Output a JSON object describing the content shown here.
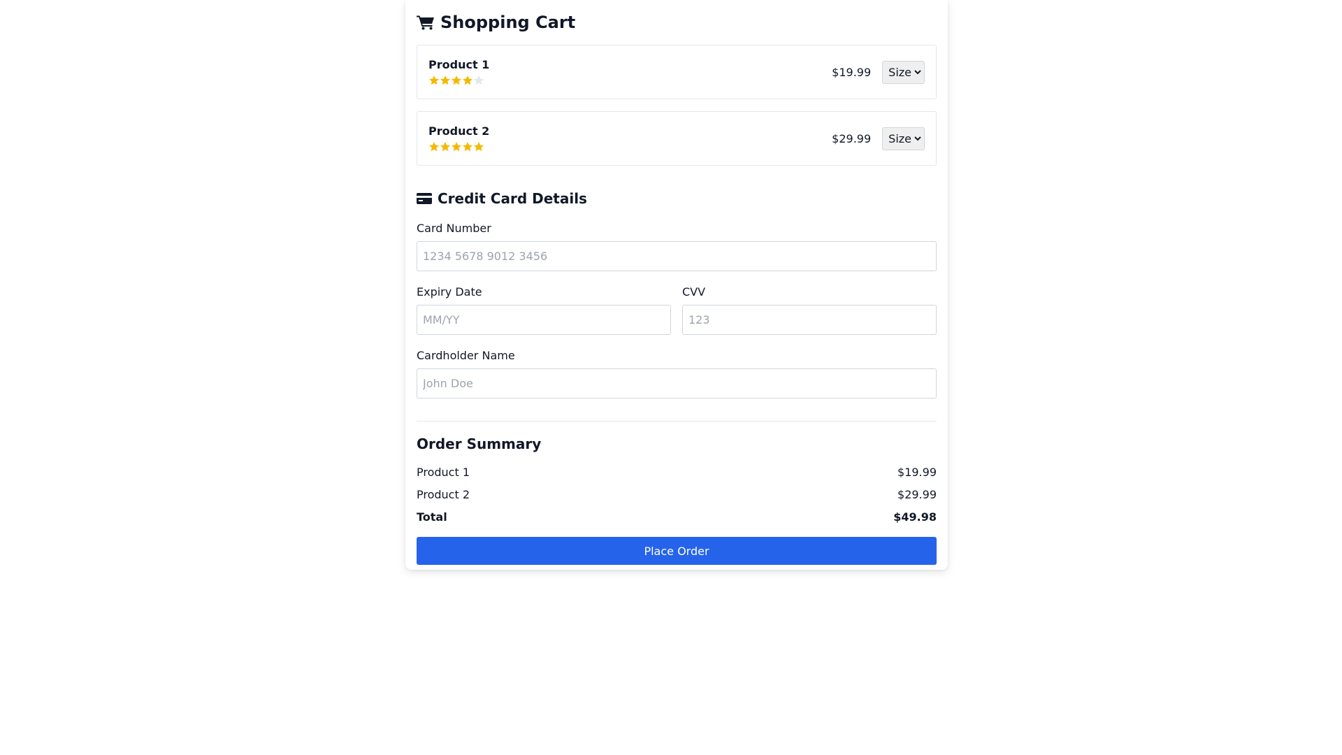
{
  "colors": {
    "accent": "#2563eb",
    "star_filled": "#f5b800",
    "star_empty": "#e5e7eb"
  },
  "cart": {
    "title": "Shopping Cart",
    "icon": "shopping-cart-icon",
    "items": [
      {
        "name": "Product 1",
        "price": "$19.99",
        "rating": 4,
        "rating_max": 5,
        "size_label": "Size"
      },
      {
        "name": "Product 2",
        "price": "$29.99",
        "rating": 5,
        "rating_max": 5,
        "size_label": "Size"
      }
    ]
  },
  "credit_card": {
    "title": "Credit Card Details",
    "icon": "credit-card-icon",
    "card_number": {
      "label": "Card Number",
      "placeholder": "1234 5678 9012 3456",
      "value": ""
    },
    "expiry": {
      "label": "Expiry Date",
      "placeholder": "MM/YY",
      "value": ""
    },
    "cvv": {
      "label": "CVV",
      "placeholder": "123",
      "value": ""
    },
    "cardholder": {
      "label": "Cardholder Name",
      "placeholder": "John Doe",
      "value": ""
    }
  },
  "summary": {
    "title": "Order Summary",
    "rows": [
      {
        "label": "Product 1",
        "amount": "$19.99"
      },
      {
        "label": "Product 2",
        "amount": "$29.99"
      }
    ],
    "total_label": "Total",
    "total_amount": "$49.98",
    "place_order_label": "Place Order"
  }
}
